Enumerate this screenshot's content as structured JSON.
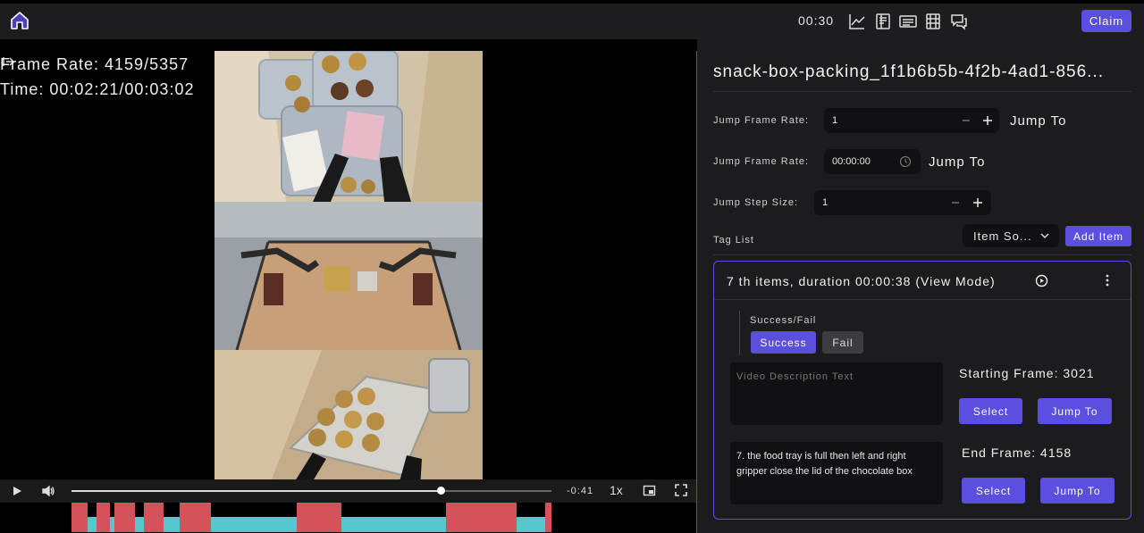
{
  "header": {
    "timer": "00:30",
    "claim_label": "Claim",
    "icons": [
      "home-icon",
      "line-chart-icon",
      "document-icon",
      "subtitles-icon",
      "table-icon",
      "chat-icon"
    ]
  },
  "video": {
    "overlay": {
      "frame_rate_text": "Frame Rate: 4159/5357",
      "time_text": "Time: 00:02:21/00:03:02"
    },
    "controls": {
      "progress": 0.77,
      "remaining": "-0:41",
      "speed": "1x"
    },
    "tag_timeline": {
      "base_color": "#55c8cf",
      "tag_color": "#d4525a",
      "segments": [
        {
          "start": 0.0,
          "end": 0.034
        },
        {
          "start": 0.052,
          "end": 0.08
        },
        {
          "start": 0.089,
          "end": 0.132
        },
        {
          "start": 0.15,
          "end": 0.192
        },
        {
          "start": 0.225,
          "end": 0.29
        },
        {
          "start": 0.47,
          "end": 0.563
        },
        {
          "start": 0.78,
          "end": 0.927
        },
        {
          "start": 0.987,
          "end": 1.0
        }
      ]
    }
  },
  "panel": {
    "title": "snack-box-packing_1f1b6b5b-4f2b-4ad1-856...",
    "jump_frame": {
      "label": "Jump Frame Rate:",
      "value": "1",
      "action": "Jump To"
    },
    "jump_time": {
      "label": "Jump Frame Rate:",
      "value": "00:00:00",
      "action": "Jump To"
    },
    "jump_step": {
      "label": "Jump Step Size:",
      "value": "1"
    },
    "tag_list": {
      "label": "Tag List",
      "sort_label": "Item So...",
      "add_label": "Add Item"
    },
    "item": {
      "header": "7 th items, duration 00:00:38 (View Mode)",
      "success_fail_label": "Success/Fail",
      "success_label": "Success",
      "fail_label": "Fail",
      "description_placeholder": "Video Description Text",
      "description_value": "",
      "instruction_text": "7. the food tray is full then left and right gripper close the lid of the chocolate box",
      "starting_frame_label": "Starting Frame:",
      "starting_frame": "3021",
      "end_frame_label": "End Frame:",
      "end_frame": "4158",
      "select_label": "Select",
      "jump_label": "Jump To"
    }
  },
  "colors": {
    "accent": "#5b4fe0",
    "panel_bg": "#1c1c1e",
    "header_bg": "#1d1d1f"
  }
}
